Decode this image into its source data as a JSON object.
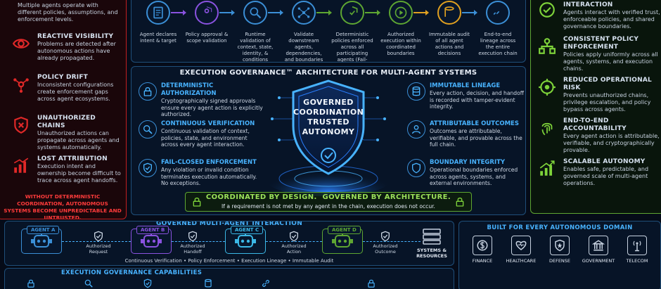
{
  "left_panel": {
    "intro_text": "Multiple agents operate with different policies, assumptions, and enforcement levels.",
    "items": [
      {
        "title": "REACTIVE VISIBILITY",
        "desc": "Problems are detected after autonomous actions have already propagated.",
        "icon": "eye-icon"
      },
      {
        "title": "POLICY DRIFT",
        "desc": "Inconsistent configurations create enforcement gaps across agent ecosystems.",
        "icon": "nodes-icon"
      },
      {
        "title": "UNAUTHORIZED CHAINS",
        "desc": "Unauthorized actions can propagate across agents and systems automatically.",
        "icon": "shield-x-icon"
      },
      {
        "title": "LOST ATTRIBUTION",
        "desc": "Execution intent and ownership become difficult to trace across agent handoffs.",
        "icon": "bar-chart-icon"
      }
    ],
    "warning": "WITHOUT DETERMINISTIC COORDINATION, AUTONOMOUS SYSTEMS BECOME UNPREDICTABLE AND UNTRUSTED."
  },
  "flow": {
    "steps": [
      {
        "label": "Agent declares intent & target",
        "icon": "document-icon",
        "color": "#3b8fd6"
      },
      {
        "label": "Policy approval & scope validation",
        "icon": "user-shield-icon",
        "color": "#8a52e0"
      },
      {
        "label": "Runtime validation of context, state, identity, & conditions",
        "icon": "magnifier-icon",
        "color": "#3b8fd6"
      },
      {
        "label": "Validate downstream agents, dependencies, and boundaries",
        "icon": "network-icon",
        "color": "#3b8fd6"
      },
      {
        "label": "Deterministic policies enforced across all participating agents (Fail-Closed)",
        "icon": "shield-check-icon",
        "color": "#5ea632"
      },
      {
        "label": "Authorized execution within coordinated boundaries",
        "icon": "play-icon",
        "color": "#5ea632"
      },
      {
        "label": "Immutable audit of all agent actions and decisions",
        "icon": "database-icon",
        "color": "#e0a020"
      },
      {
        "label": "End-to-end lineage across the entire execution chain",
        "icon": "link-icon",
        "color": "#3b8fd6"
      }
    ]
  },
  "right_panel": {
    "header": "TRUSTED AI-TO-AI INTERACTION",
    "intro_text": "Agents interact with verified trust, enforceable policies, and shared governance boundaries.",
    "items": [
      {
        "title": "CONSISTENT POLICY ENFORCEMENT",
        "desc": "Policies apply uniformly across all agents, systems, and execution chains.",
        "icon": "org-chart-icon"
      },
      {
        "title": "REDUCED OPERATIONAL RISK",
        "desc": "Prevents unauthorized chains, privilege escalation, and policy bypass across agents.",
        "icon": "target-icon"
      },
      {
        "title": "END-TO-END ACCOUNTABILITY",
        "desc": "Every agent action is attributable, verifiable, and cryptographically provable.",
        "icon": "fingerprint-icon"
      },
      {
        "title": "SCALABLE AUTONOMY",
        "desc": "Enables safe, predictable, and governed scale of multi-agent operations.",
        "icon": "growth-chart-icon"
      }
    ]
  },
  "architecture": {
    "title": "EXECUTION GOVERNANCE™ ARCHITECTURE FOR MULTI-AGENT SYSTEMS",
    "shield_lines": [
      "GOVERNED",
      "COORDINATION",
      "TRUSTED",
      "AUTONOMY"
    ],
    "left_items": [
      {
        "title": "DETERMINISTIC AUTHORIZATION",
        "desc": "Cryptographically signed approvals ensure every agent action is explicitly authorized.",
        "icon": "lock-icon"
      },
      {
        "title": "CONTINUOUS VERIFICATION",
        "desc": "Continuous validation of context, policies, state, and environment across every agent interaction.",
        "icon": "magnifier-icon"
      },
      {
        "title": "FAIL-CLOSED ENFORCEMENT",
        "desc": "Any violation or invalid condition terminates execution automatically. No exceptions.",
        "icon": "shield-check-icon"
      }
    ],
    "right_items": [
      {
        "title": "IMMUTABLE LINEAGE",
        "desc": "Every action, decision, and handoff is recorded with tamper-evident integrity.",
        "icon": "database-icon"
      },
      {
        "title": "ATTRIBUTABLE OUTCOMES",
        "desc": "Outcomes are attributable, verifiable, and provable across the full chain.",
        "icon": "person-icon"
      },
      {
        "title": "BOUNDARY INTEGRITY",
        "desc": "Operational boundaries enforced across agents, systems, and external environments.",
        "icon": "shield-icon"
      }
    ],
    "banner_main": "COORDINATED BY DESIGN.  GOVERNED BY ARCHITECTURE.",
    "banner_sub": "If a requirement is not met by any agent in the chain, execution does not occur."
  },
  "interaction": {
    "title": "GOVERNED MULTI-AGENT INTERACTION",
    "agents": [
      {
        "label": "AGENT A",
        "color": "#3b8fd6"
      },
      {
        "label": "AGENT B",
        "color": "#8a52e0"
      },
      {
        "label": "AGENT C",
        "color": "#3bb8e6"
      },
      {
        "label": "AGENT D",
        "color": "#5ea632"
      }
    ],
    "handoffs": [
      "Authorized Request",
      "Authorized Handoff",
      "Authorized Action",
      "Authorized Outcome"
    ],
    "systems_label": "SYSTEMS & RESOURCES",
    "footer": "Continuous Verification  •  Policy Enforcement  •  Execution Lineage  •  Immutable Audit"
  },
  "capabilities": {
    "title": "EXECUTION GOVERNANCE CAPABILITIES"
  },
  "domains": {
    "title": "BUILT FOR EVERY AUTONOMOUS DOMAIN",
    "items": [
      {
        "label": "FINANCE",
        "icon": "dollar-icon"
      },
      {
        "label": "HEALTHCARE",
        "icon": "heart-icon"
      },
      {
        "label": "DEFENSE",
        "icon": "badge-icon"
      },
      {
        "label": "GOVERNMENT",
        "icon": "building-icon"
      },
      {
        "label": "TELECOM",
        "icon": "antenna-icon"
      }
    ]
  },
  "colors": {
    "accent_blue": "#48b3ff",
    "danger_red": "#e02828",
    "success_green": "#7ed33a",
    "warning_amber": "#e0a020"
  }
}
